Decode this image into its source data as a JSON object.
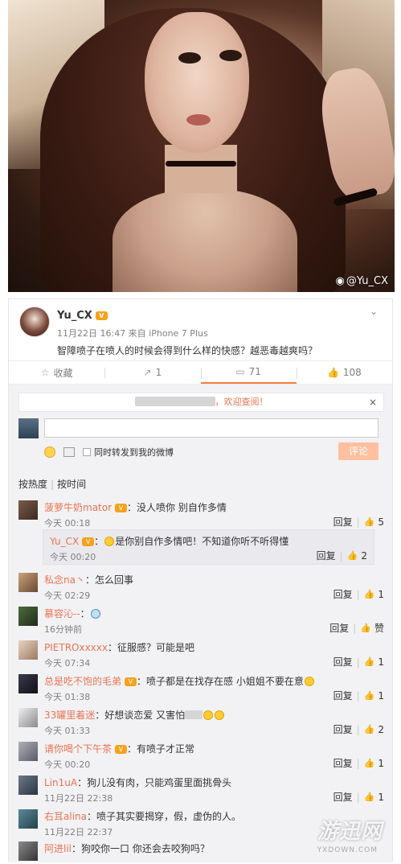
{
  "photo": {
    "watermark": "@Yu_CX",
    "weibo_logo": "weibo-logo-icon"
  },
  "post": {
    "username": "Yu_CX",
    "vip_badge": "vip-badge-icon",
    "meta": "11月22日 16:47 来自 iPhone 7 Plus",
    "text": "智障喷子在喷人的时候会得到什么样的快感？越恶毒越爽吗？",
    "actions": {
      "favorite": "收藏",
      "forward": "1",
      "comment": "71",
      "like": "108"
    }
  },
  "comment_box": {
    "welcome": "，欢迎查阅！",
    "close": "×",
    "also_forward": "同时转发到我的微博",
    "submit": "评论"
  },
  "sort": {
    "hot": "按热度",
    "time": "按时间"
  },
  "labels": {
    "reply": "回复"
  },
  "comments": [
    {
      "nick": "菠萝牛奶mator",
      "text": "：没人喷你 别自作多情",
      "time": "今天 00:18",
      "likes": "5"
    },
    {
      "nick": "Yu_CX",
      "text": "是你别自作多情吧！不知道你听不听得懂",
      "time": "今天 00:20",
      "likes": "2"
    },
    {
      "nick": "私念na丶",
      "text": "：怎么回事",
      "time": "今天 02:29",
      "likes": "1"
    },
    {
      "nick": "慕容沁--",
      "text": "：",
      "time": "16分钟前",
      "likes": "赞"
    },
    {
      "nick": "PIETROxxxxx",
      "text": "：征服感？可能是吧",
      "time": "今天 07:34",
      "likes": "1"
    },
    {
      "nick": "总是吃不饱的毛弟",
      "text": "：喷子都是在找存在感 小姐姐不要在意",
      "time": "今天 01:38",
      "likes": "1"
    },
    {
      "nick": "33罐里着迷",
      "text": "：好想谈恋爱 又害怕",
      "time": "今天 01:33",
      "likes": "2"
    },
    {
      "nick": "请你喝个下午茶",
      "text": "：有喷子才正常",
      "time": "今天 00:20",
      "likes": "1"
    },
    {
      "nick": "Lin1uA",
      "text": "：狗儿没有肉，只能鸡蛋里面挑骨头",
      "time": "11月22日 22:38",
      "likes": "1"
    },
    {
      "nick": "右耳alina",
      "text": "：喷子其实要揭穿，假，虚伪的人。",
      "time": "11月22日 22:37",
      "likes": ""
    },
    {
      "nick": "阿进lil",
      "text": "：狗咬你一口 你还会去咬狗吗？",
      "time": "",
      "likes": ""
    }
  ],
  "site_watermark": {
    "logo": "游迅网",
    "url": "YXDOWN.COM"
  },
  "colors": {
    "nick": "#eb7350",
    "submit_bg": "#ffc09f",
    "vip": "#f7a21b",
    "comment_bg": "#f2f2f5"
  }
}
